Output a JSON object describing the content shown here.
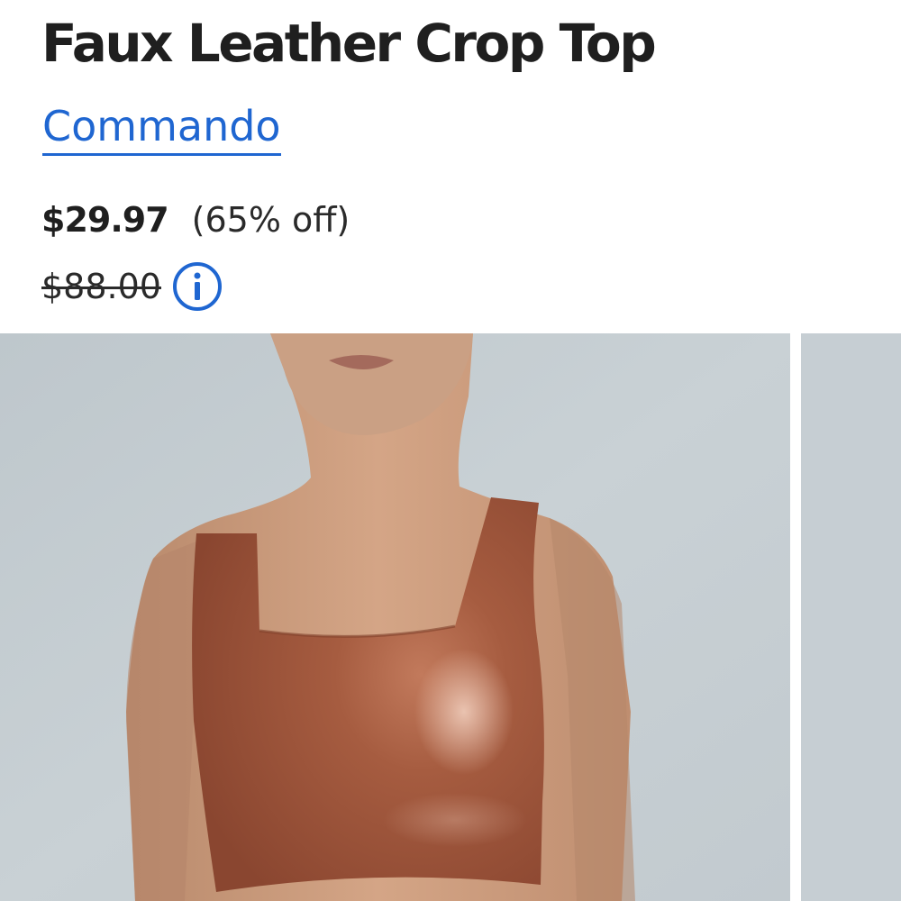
{
  "product": {
    "title": "Faux Leather Crop Top",
    "brand": "Commando",
    "price": {
      "current": "$29.97",
      "discount": "(65% off)",
      "original": "$88.00"
    }
  },
  "icons": {
    "price_info": "info-icon"
  },
  "colors": {
    "link": "#1f66d1",
    "text": "#1f1f1f",
    "photo_background": "#c5cdd2",
    "top_color": "#a75a3e"
  }
}
